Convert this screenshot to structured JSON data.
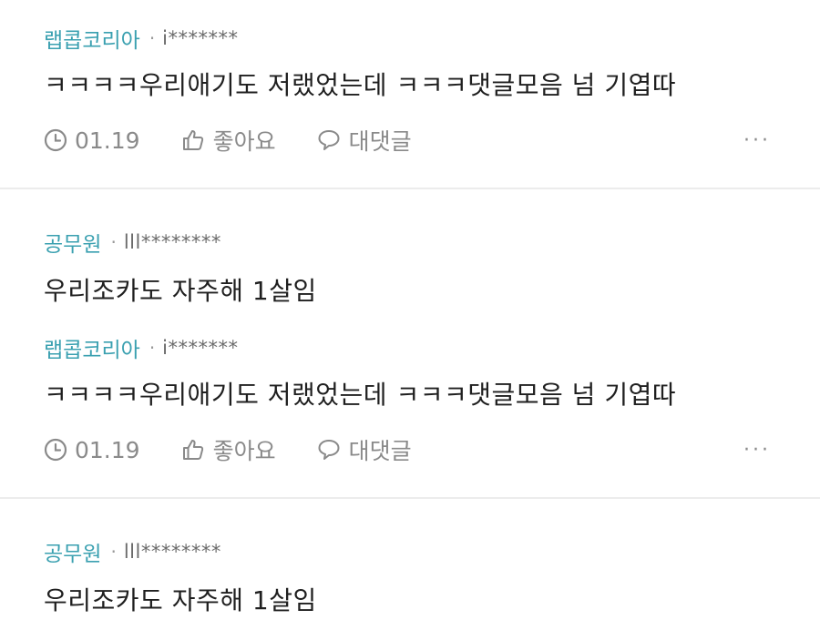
{
  "comments": [
    {
      "author": "랩콥코리아",
      "masked": "i*******",
      "text": "ㅋㅋㅋㅋ우리애기도 저랬었는데 ㅋㅋㅋ댓글모음 넘 기엽따",
      "date": "01.19",
      "like_label": "좋아요",
      "reply_label": "대댓글"
    },
    {
      "author": "공무원",
      "masked": "lll********",
      "text": "우리조카도 자주해 1살임"
    },
    {
      "author": "랩콥코리아",
      "masked": "i*******",
      "text": "ㅋㅋㅋㅋ우리애기도 저랬었는데 ㅋㅋㅋ댓글모음 넘 기엽따",
      "date": "01.19",
      "like_label": "좋아요",
      "reply_label": "대댓글"
    },
    {
      "author": "공무원",
      "masked": "lll********",
      "text": "우리조카도 자주해 1살임"
    }
  ],
  "meta_separator": "·",
  "more_label": "···",
  "colors": {
    "author": "#3aa0b0",
    "divider": "#ececec",
    "icon": "#8a8a8a"
  },
  "icons": {
    "date": "clock-icon",
    "like": "thumbs-up-icon",
    "reply": "speech-bubble-icon",
    "more": "more-icon"
  }
}
